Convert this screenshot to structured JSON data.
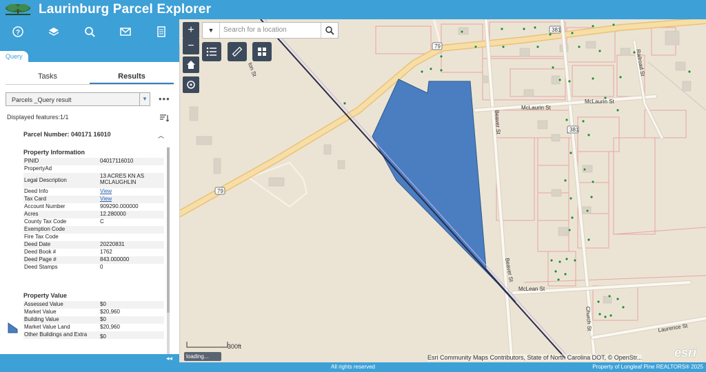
{
  "app": {
    "title": "Laurinburg Parcel Explorer"
  },
  "toolbar": {
    "items": [
      "help-icon",
      "layers-icon",
      "search-icon",
      "mail-icon",
      "document-icon"
    ]
  },
  "panel": {
    "tab": "Query",
    "subtabs": [
      "Tasks",
      "Results"
    ],
    "active_subtab": "Results",
    "layer_select": "Parcels _Query result",
    "more": "•••",
    "displayed": "Displayed features:1/1",
    "parcel_number": "Parcel Number: 040171 16010",
    "section_info": "Property Information",
    "attributes": [
      {
        "k": "PINID",
        "v": "04017116010"
      },
      {
        "k": "PropertyAd",
        "v": ""
      },
      {
        "k": "Legal Description",
        "v": "13 ACRES KN AS MCLAUGHLIN"
      },
      {
        "k": "Deed Info",
        "v": "View"
      },
      {
        "k": "Tax Card",
        "v": "View"
      },
      {
        "k": "Account Number",
        "v": "909290.000000"
      },
      {
        "k": "Acres",
        "v": "12.280000"
      },
      {
        "k": "County Tax Code",
        "v": "C"
      },
      {
        "k": "Exemption Code",
        "v": ""
      },
      {
        "k": "Fire Tax Code",
        "v": ""
      },
      {
        "k": "Deed Date",
        "v": "20220831"
      },
      {
        "k": "Deed Book #",
        "v": "1762"
      },
      {
        "k": "Deed Page #",
        "v": "843.000000"
      },
      {
        "k": "Deed Stamps",
        "v": "0"
      }
    ],
    "section_value": "Property Value",
    "values": [
      {
        "k": "Assessed Value",
        "v": "$0"
      },
      {
        "k": "Market Value",
        "v": "$20,960"
      },
      {
        "k": "Building Value",
        "v": "$0"
      },
      {
        "k": "Market Value Land",
        "v": "$20,960"
      },
      {
        "k": "Other Buildings and Extra",
        "v": "$0"
      }
    ],
    "collapse": "◂◂"
  },
  "map": {
    "search_placeholder": "Search for a location",
    "scale": "300ft",
    "loading": "loading...",
    "attribution": "Esri Community Maps Contributors, State of North Carolina DOT, © OpenStr...",
    "esri": "esri",
    "road_labels": [
      "McLaurin St",
      "McLaurin St",
      "Beaver St",
      "Beaver St",
      "McLean St",
      "Church St",
      "Laurence St",
      "Railroad St",
      "79",
      "79",
      "381",
      "381"
    ],
    "colors": {
      "parcel": "#4a7ec0",
      "road": "#f5dca0",
      "lot_line": "#e7a0a0",
      "rail": "#2a2a4a"
    }
  },
  "footer": {
    "copyright": "All rights reserved",
    "watermark": "Property of Longleaf Pine REALTORS® 2025"
  }
}
